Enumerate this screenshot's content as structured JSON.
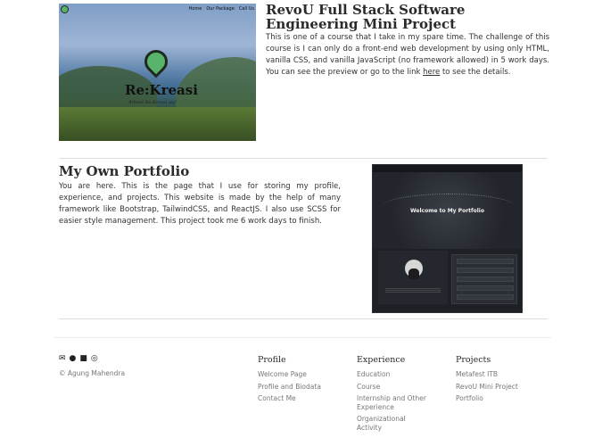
{
  "project1": {
    "image": {
      "brand": "Re:Kreasi",
      "tagline": "Arbani Re:Kreasi wa!",
      "nav": [
        "Home",
        "Our Package",
        "Call Us"
      ]
    },
    "title": "RevoU Full Stack Software Engineering Mini Project",
    "description_before_link": "This is one of a course that I take in my spare time. The challenge of this course is I can only do a front-end web development by using only HTML, vanilla CSS, and vanilla JavaScript (no framework allowed) in 5 work days. You can see the preview or go to the link ",
    "link_text": "here",
    "description_after_link": " to see the details."
  },
  "project2": {
    "title": "My Own Portfolio",
    "description": "You are here. This is the page that I use for storing my profile, experience, and projects. This website is made by the help of many framework like Bootstrap, TailwindCSS, and ReactJS. I also use SCSS for easier style management. This project took me 6 work days to finish.",
    "image": {
      "hero_title": "Welcome to My Portfolio"
    }
  },
  "footer": {
    "icons": [
      "mail-icon",
      "github-icon",
      "linkedin-icon",
      "whatsapp-icon"
    ],
    "copyright": "© Agung Mahendra",
    "columns": [
      {
        "title": "Profile",
        "items": [
          "Welcome Page",
          "Profile and Biodata",
          "Contact Me"
        ]
      },
      {
        "title": "Experience",
        "items": [
          "Education",
          "Course",
          "Internship and Other Experience",
          "Organizational Activity"
        ]
      },
      {
        "title": "Projects",
        "items": [
          "Metafest ITB",
          "RevoU Mini Project",
          "Portfolio"
        ]
      }
    ]
  }
}
